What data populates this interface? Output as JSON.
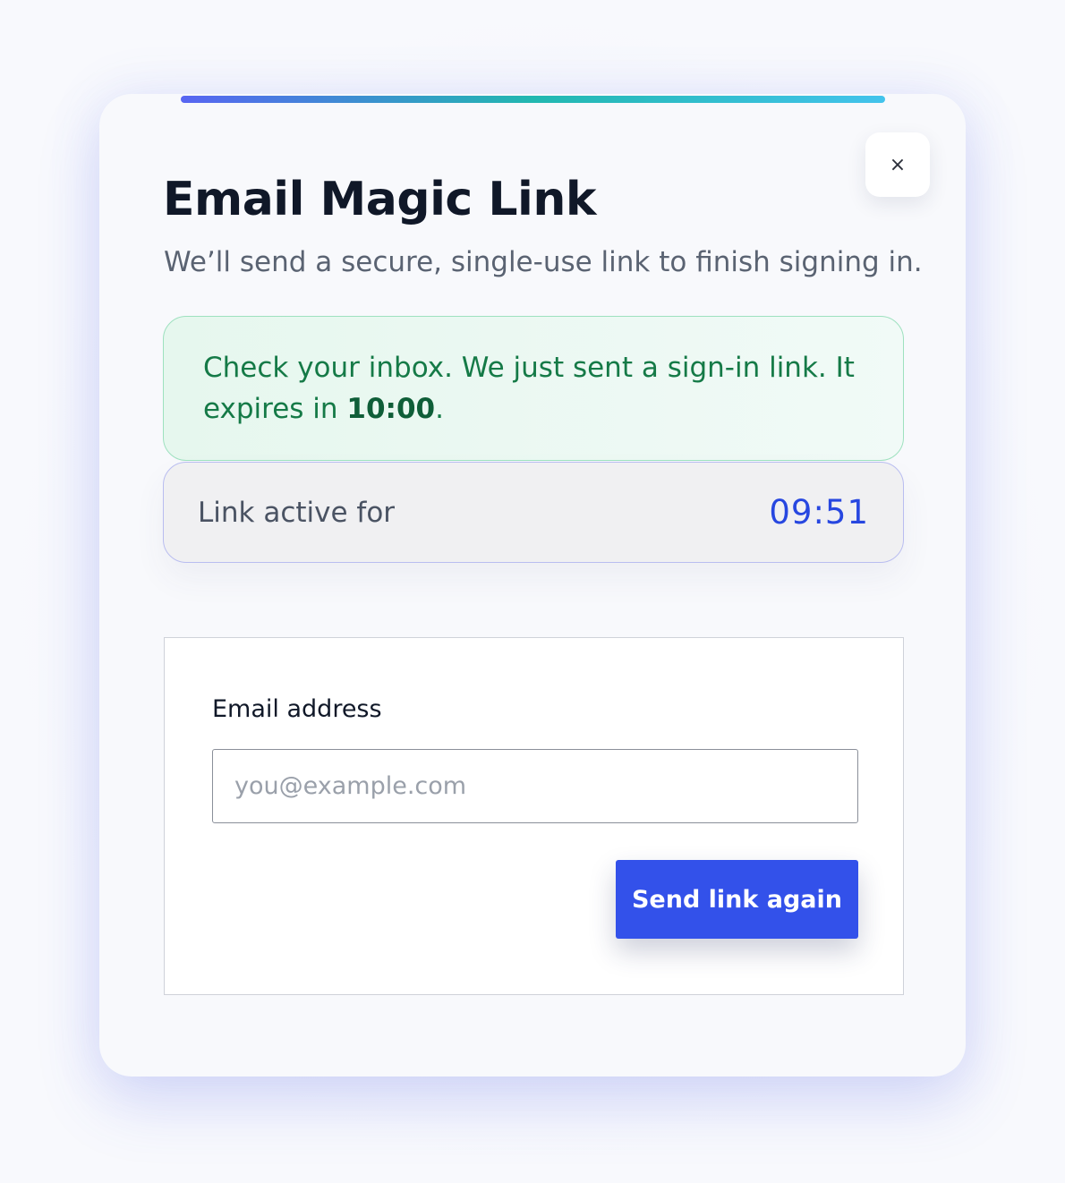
{
  "dialog": {
    "title": "Email Magic Link",
    "subtitle": "We’ll send a secure, single-use link to finish signing in.",
    "close_glyph": "×"
  },
  "notice": {
    "text_before": "Check your inbox. We just sent a sign-in link. It expires in ",
    "expiry": "10:00",
    "text_after": "."
  },
  "timer": {
    "label": "Link active for",
    "value": "09:51"
  },
  "form": {
    "email_label": "Email address",
    "email_value": "",
    "email_placeholder": "you@example.com",
    "submit_label": "Send link again"
  },
  "colors": {
    "accent": "#3351ea",
    "success_text": "#157a47",
    "timer_value": "#2747e0"
  },
  "icons": {
    "close": "close-icon"
  }
}
